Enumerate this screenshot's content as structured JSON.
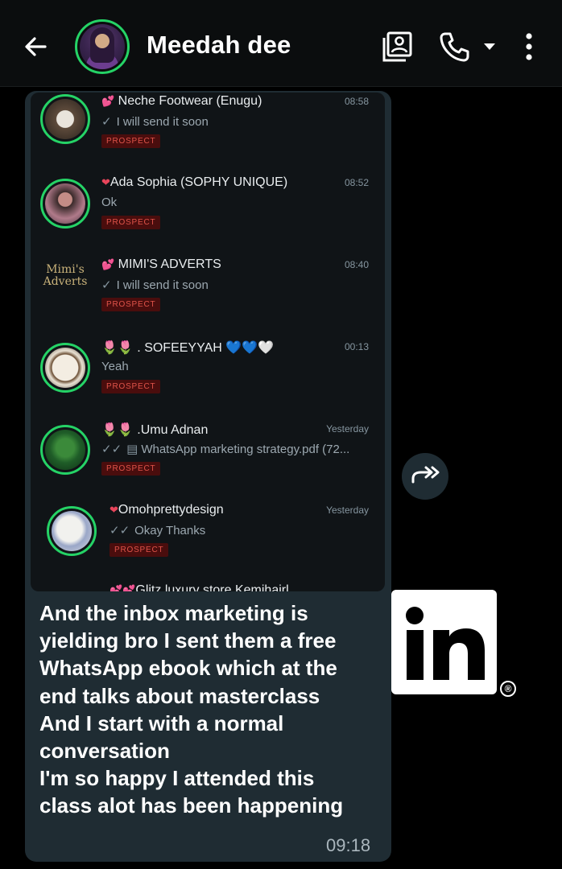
{
  "header": {
    "contact_name": "Meedah dee"
  },
  "chat_list": [
    {
      "name": "Neche Footwear (Enugu)",
      "time": "08:58",
      "message": "I will send it soon",
      "status": "sent",
      "tag": "PROSPECT",
      "prefix": "💕"
    },
    {
      "name": "Ada Sophia (SOPHY UNIQUE)",
      "time": "08:52",
      "message": "Ok",
      "status": "none",
      "tag": "PROSPECT",
      "prefix": "❤"
    },
    {
      "name": "MIMI'S ADVERTS",
      "time": "08:40",
      "message": "I will send it soon",
      "status": "sent",
      "tag": "PROSPECT",
      "prefix": "💕"
    },
    {
      "name": ". SOFEEYYAH 💙💙🤍",
      "time": "00:13",
      "message": "Yeah",
      "status": "none",
      "tag": "PROSPECT",
      "prefix": "🌷🌷"
    },
    {
      "name": ".Umu Adnan",
      "time": "Yesterday",
      "message": "WhatsApp marketing strategy.pdf (72...",
      "status": "read",
      "tag": "PROSPECT",
      "prefix": "🌷🌷"
    },
    {
      "name": "Omohprettydesign",
      "time": "Yesterday",
      "message": "Okay Thanks",
      "status": "read",
      "tag": "PROSPECT",
      "prefix": "❤"
    },
    {
      "name": "Glitz luxury store Kemihairl",
      "prefix": "💕💕"
    }
  ],
  "mimi_logo_text": [
    "Mimi's",
    "Adverts"
  ],
  "message": {
    "lines": [
      "And the inbox marketing is",
      "yielding bro I sent them a free",
      "WhatsApp ebook which at the",
      "end talks about masterclass",
      "And I start with a normal",
      "conversation",
      "I'm so happy I attended this",
      "class alot has been happening"
    ],
    "timestamp": "09:18"
  },
  "watermark": {
    "logo_text": "in",
    "registered_mark": "®"
  },
  "colors": {
    "accent": "#25d366",
    "bubble": "#1f2c33",
    "tag_bg": "#4a0d0d",
    "tag_text": "#e0544a"
  }
}
